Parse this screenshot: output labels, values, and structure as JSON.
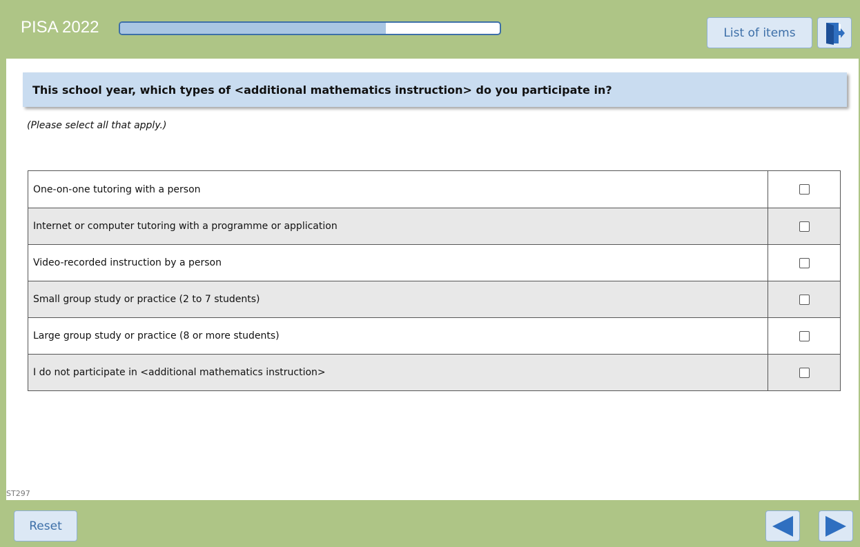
{
  "header": {
    "title": "PISA 2022",
    "progress_fraction": 0.7,
    "list_of_items_label": "List of items",
    "exit_icon": "exit-door-icon"
  },
  "question": {
    "text": "This school year, which types of <additional mathematics instruction> do you participate in?",
    "instruction": "(Please select all that apply.)",
    "options": [
      {
        "label": "One-on-one tutoring with a person",
        "checked": false
      },
      {
        "label": "Internet or computer tutoring with a programme or application",
        "checked": false
      },
      {
        "label": "Video-recorded instruction by a person",
        "checked": false
      },
      {
        "label": "Small group study or practice (2 to 7 students)",
        "checked": false
      },
      {
        "label": "Large group study or practice (8 or more students)",
        "checked": false
      },
      {
        "label": "I do not participate in <additional mathematics instruction>",
        "checked": false
      }
    ],
    "item_code": "ST297"
  },
  "footer": {
    "reset_label": "Reset",
    "prev_icon": "arrow-left-icon",
    "next_icon": "arrow-right-icon"
  },
  "colors": {
    "background": "#aec586",
    "question_bar": "#c9dcf0",
    "button_bg": "#dce8f5",
    "accent": "#3d6fa8",
    "nav_arrow": "#2f6fc0"
  }
}
